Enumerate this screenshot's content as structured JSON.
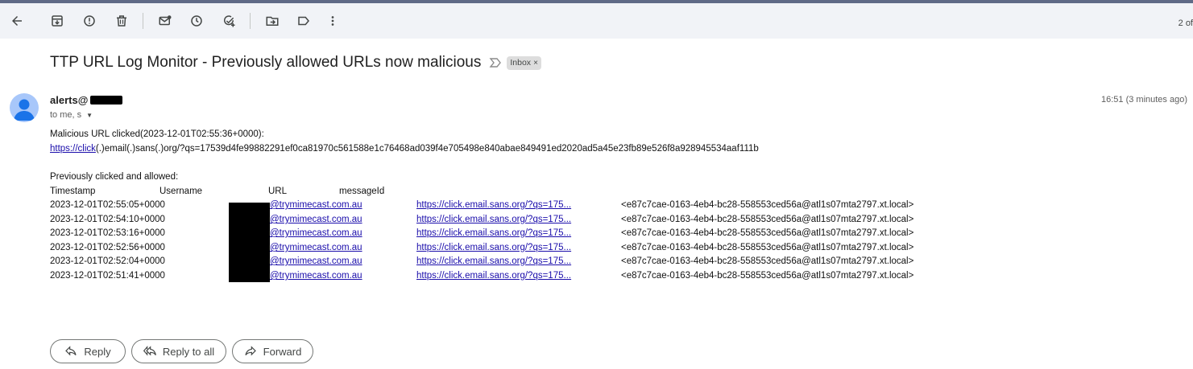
{
  "toolbar": {
    "icons": [
      "back-arrow-icon",
      "archive-icon",
      "report-spam-icon",
      "delete-icon",
      "mark-unread-icon",
      "snooze-icon",
      "add-task-icon",
      "move-to-icon",
      "label-icon",
      "more-vert-icon"
    ],
    "pager_text": "2 of"
  },
  "email": {
    "subject": "TTP URL Log Monitor - Previously allowed URLs now malicious",
    "label": "Inbox",
    "sender": "alerts@",
    "recipients": "to me, s",
    "time": "16:51 (3 minutes ago)",
    "line1": "Malicious URL clicked(2023-12-01T02:55:36+0000):",
    "link_part": "https://click",
    "link_rest": "(.)email(.)sans(.)org/?qs=17539d4fe99882291ef0ca81970c561588e1c76468ad039f4e705498e840abae849491ed2020ad5a45e23fb89e526f8a928945534aaf111b",
    "prev_heading": "Previously clicked and allowed:",
    "table": {
      "headers": [
        "Timestamp",
        "Username",
        "URL",
        "messageId"
      ],
      "rows": [
        {
          "ts": "2023-12-01T02:55:05+0000",
          "user": "@trymimecast.com.au",
          "url": "https://click.email.sans.org/?qs=175...",
          "mid": "<e87c7cae-0163-4eb4-bc28-558553ced56a@atl1s07mta2797.xt.local>"
        },
        {
          "ts": "2023-12-01T02:54:10+0000",
          "user": "@trymimecast.com.au",
          "url": "https://click.email.sans.org/?qs=175...",
          "mid": "<e87c7cae-0163-4eb4-bc28-558553ced56a@atl1s07mta2797.xt.local>"
        },
        {
          "ts": "2023-12-01T02:53:16+0000",
          "user": "@trymimecast.com.au",
          "url": "https://click.email.sans.org/?qs=175...",
          "mid": "<e87c7cae-0163-4eb4-bc28-558553ced56a@atl1s07mta2797.xt.local>"
        },
        {
          "ts": "2023-12-01T02:52:56+0000",
          "user": "@trymimecast.com.au",
          "url": "https://click.email.sans.org/?qs=175...",
          "mid": "<e87c7cae-0163-4eb4-bc28-558553ced56a@atl1s07mta2797.xt.local>"
        },
        {
          "ts": "2023-12-01T02:52:04+0000",
          "user": "@trymimecast.com.au",
          "url": "https://click.email.sans.org/?qs=175...",
          "mid": "<e87c7cae-0163-4eb4-bc28-558553ced56a@atl1s07mta2797.xt.local>"
        },
        {
          "ts": "2023-12-01T02:51:41+0000",
          "user": "@trymimecast.com.au",
          "url": "https://click.email.sans.org/?qs=175...",
          "mid": "<e87c7cae-0163-4eb4-bc28-558553ced56a@atl1s07mta2797.xt.local>"
        }
      ]
    }
  },
  "actions": {
    "reply": "Reply",
    "reply_all": "Reply to all",
    "forward": "Forward"
  },
  "colors": {
    "toolbar_bg": "#f1f3f7",
    "link": "#1a0dab",
    "avatar": "#a8c7fa"
  }
}
